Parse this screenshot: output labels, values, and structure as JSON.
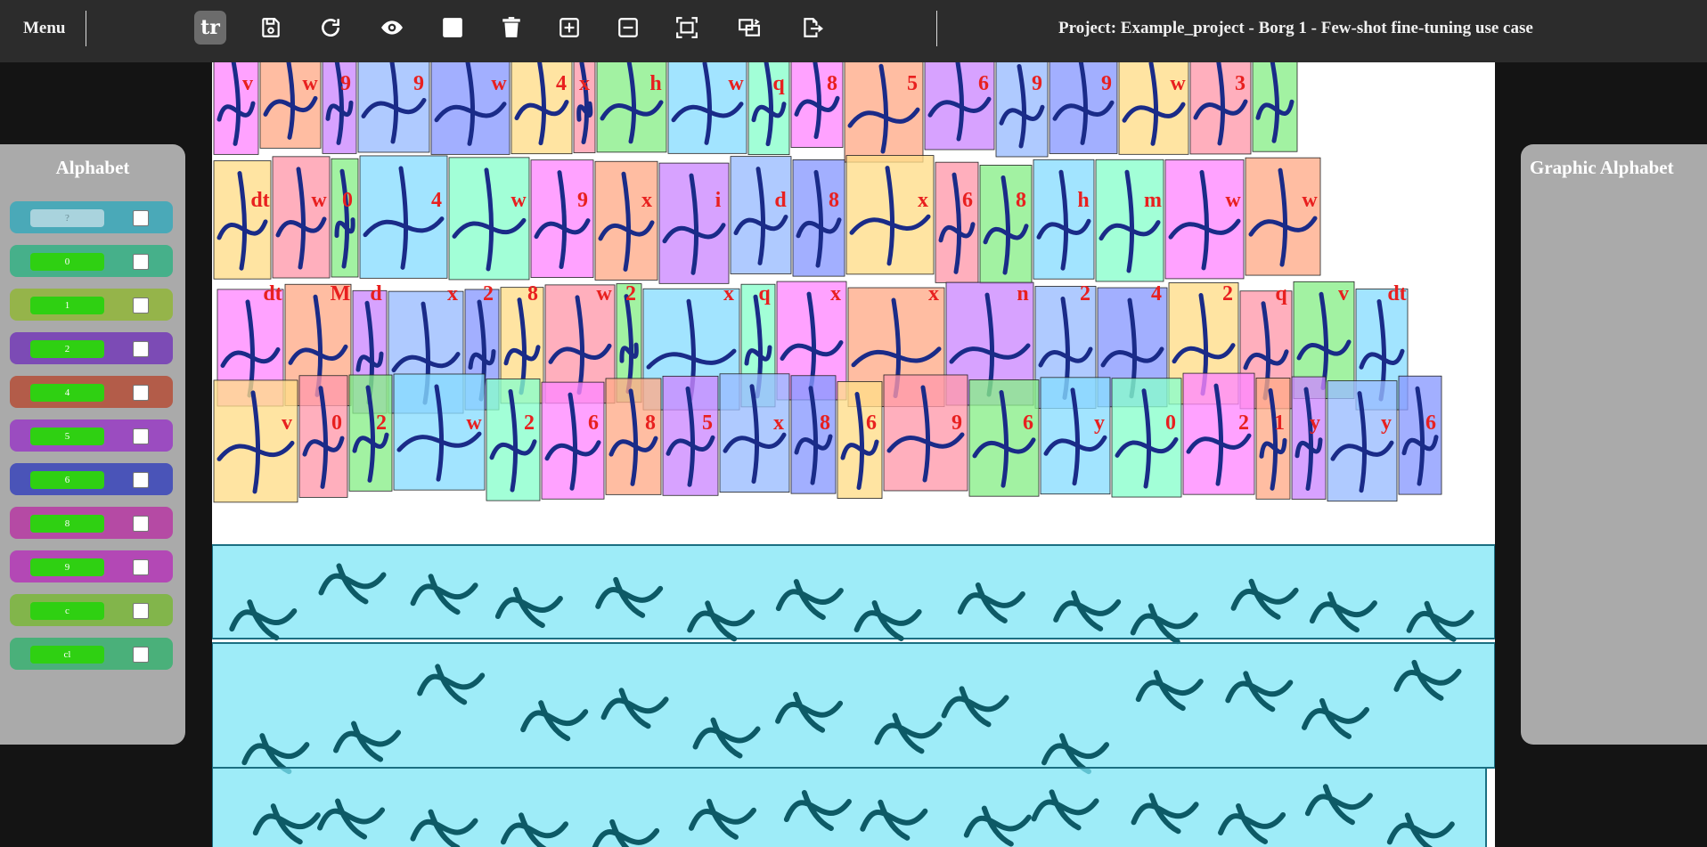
{
  "topbar": {
    "menu_label": "Menu",
    "tools": [
      {
        "name": "tr-tool",
        "label": "tr",
        "icon": "text-tool-icon",
        "active": true
      },
      {
        "name": "save-button",
        "icon": "save-icon"
      },
      {
        "name": "redo-button",
        "icon": "redo-icon"
      },
      {
        "name": "visibility-button",
        "icon": "eye-icon"
      },
      {
        "name": "box-button",
        "icon": "filled-square-icon"
      },
      {
        "name": "delete-button",
        "icon": "trash-icon"
      },
      {
        "name": "add-box-button",
        "icon": "plus-square-icon"
      },
      {
        "name": "remove-box-button",
        "icon": "minus-square-icon"
      },
      {
        "name": "fit-box-button",
        "icon": "fit-frame-icon"
      },
      {
        "name": "transfer-button",
        "icon": "swap-frame-icon"
      },
      {
        "name": "export-button",
        "icon": "file-export-icon"
      }
    ],
    "project_title": "Project: Example_project - Borg 1 - Few-shot fine-tuning use case"
  },
  "alphabet_panel": {
    "title": "Alphabet",
    "items": [
      {
        "label": "?",
        "color": "#4aa9b8",
        "unknown": true
      },
      {
        "label": "0",
        "color": "#46b08a"
      },
      {
        "label": "1",
        "color": "#95b44a"
      },
      {
        "label": "2",
        "color": "#7c4bb5"
      },
      {
        "label": "4",
        "color": "#b35c49"
      },
      {
        "label": "5",
        "color": "#9b4cc0"
      },
      {
        "label": "6",
        "color": "#4a54b8"
      },
      {
        "label": "8",
        "color": "#b54aa4"
      },
      {
        "label": "9",
        "color": "#b348b5"
      },
      {
        "label": "c",
        "color": "#82b54b"
      },
      {
        "label": "cl",
        "color": "#4ab07a"
      }
    ]
  },
  "graphic_alphabet_panel": {
    "title": "Graphic Alphabet"
  },
  "doc": {
    "line_labels": [
      {
        "row": 0,
        "labels": [
          "v",
          "w",
          "9",
          "9",
          "w",
          "4",
          "x",
          "h",
          "w",
          "q",
          "8",
          "5",
          "6",
          "9",
          "9",
          "w",
          "3"
        ]
      },
      {
        "row": 1,
        "labels": [
          "dt",
          "w",
          "0",
          "4",
          "w",
          "9",
          "x",
          "i",
          "d",
          "8",
          "x",
          "6",
          "8",
          "h",
          "m",
          "w",
          "w"
        ]
      },
      {
        "row": 2,
        "labels": [
          "dt",
          "M",
          "d",
          "x",
          "2",
          "8",
          "w",
          "2",
          "x",
          "q",
          "x",
          "x",
          "n",
          "2",
          "4",
          "2",
          "q",
          "v",
          "dt"
        ]
      },
      {
        "row": 3,
        "labels": [
          "v",
          "0",
          "2",
          "w",
          "2",
          "6",
          "8",
          "5",
          "x",
          "8",
          "6",
          "9",
          "6",
          "y",
          "0",
          "2",
          "1",
          "y",
          "y",
          "6"
        ]
      }
    ]
  },
  "colors": {
    "topbar_bg": "#2c2c2c",
    "label_red": "#e8201f",
    "line_box": "#7de6f5"
  }
}
